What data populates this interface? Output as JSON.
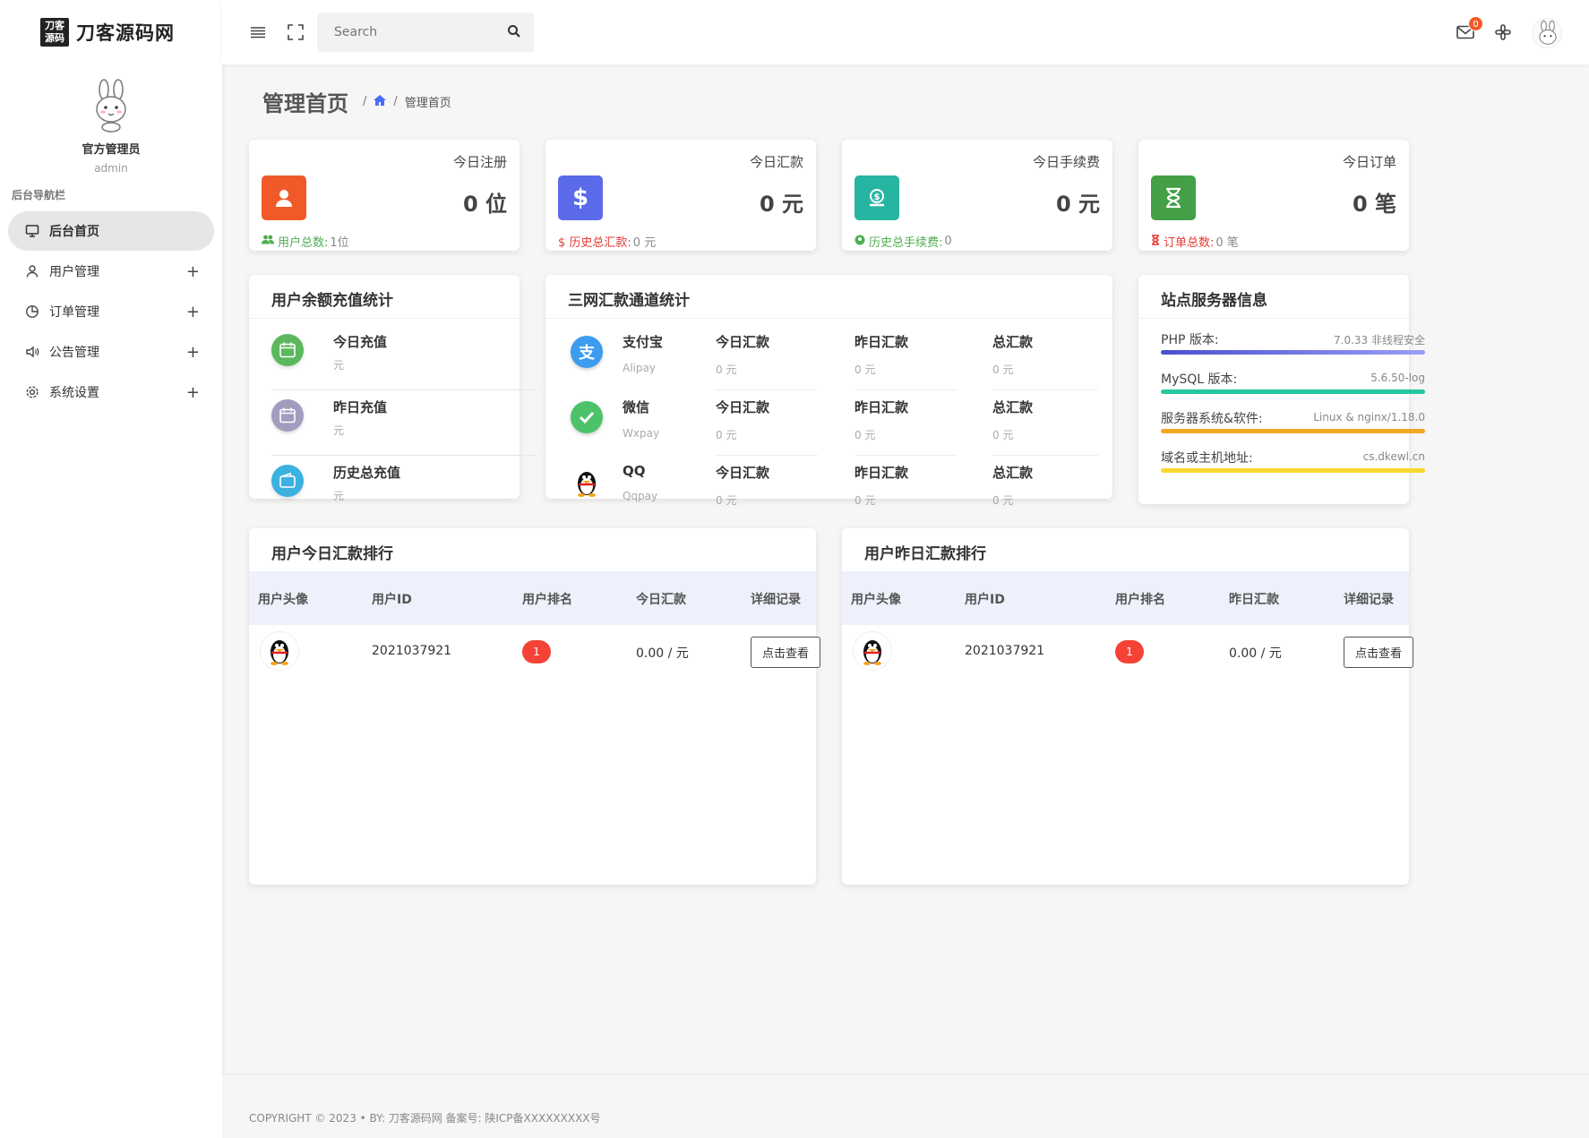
{
  "brand": {
    "logo_mark": "刀客源码",
    "name": "刀客源码网"
  },
  "profile": {
    "name": "官方管理员",
    "role": "admin"
  },
  "sidebar": {
    "title": "后台导航栏",
    "items": [
      {
        "label": "后台首页",
        "icon": "monitor-icon"
      },
      {
        "label": "用户管理",
        "icon": "user-icon"
      },
      {
        "label": "订单管理",
        "icon": "pie-chart-icon"
      },
      {
        "label": "公告管理",
        "icon": "speaker-icon"
      },
      {
        "label": "系统设置",
        "icon": "gear-icon"
      }
    ]
  },
  "topbar": {
    "search_placeholder": "Search",
    "mail_badge": "0"
  },
  "page": {
    "title": "管理首页",
    "breadcrumb": "管理首页"
  },
  "stats": [
    {
      "label": "今日注册",
      "value": "0 位",
      "foot_label": "用户总数:",
      "foot_value": "1位",
      "color": "#f05a28",
      "foot_color": "#4caf50"
    },
    {
      "label": "今日汇款",
      "value": "0 元",
      "foot_label": "$ 历史总汇款:",
      "foot_value": "0 元",
      "color": "#5a6ae8",
      "foot_color": "#e53935"
    },
    {
      "label": "今日手续费",
      "value": "0 元",
      "foot_label": "历史总手续费:",
      "foot_value": "0",
      "color": "#26b5a0",
      "foot_color": "#4caf50"
    },
    {
      "label": "今日订单",
      "value": "0 笔",
      "foot_label": "订单总数:",
      "foot_value": "0 笔",
      "color": "#43a047",
      "foot_color": "#e53935"
    }
  ],
  "recharge": {
    "title": "用户余额充值统计",
    "items": [
      {
        "label": "今日充值",
        "unit": "元",
        "color": "#5cb85c"
      },
      {
        "label": "昨日充值",
        "unit": "元",
        "color": "#a49bc0"
      },
      {
        "label": "历史总充值",
        "unit": "元",
        "color": "#3bb1e0"
      }
    ]
  },
  "channels": {
    "title": "三网汇款通道统计",
    "rows": [
      {
        "name": "支付宝",
        "en": "Alipay",
        "today": "今日汇款",
        "today_v": "0 元",
        "yest": "昨日汇款",
        "yest_v": "0 元",
        "total": "总汇款",
        "total_v": "0 元"
      },
      {
        "name": "微信",
        "en": "Wxpay",
        "today": "今日汇款",
        "today_v": "0 元",
        "yest": "昨日汇款",
        "yest_v": "0 元",
        "total": "总汇款",
        "total_v": "0 元"
      },
      {
        "name": "QQ",
        "en": "Qqpay",
        "today": "今日汇款",
        "today_v": "0 元",
        "yest": "昨日汇款",
        "yest_v": "0 元",
        "total": "总汇款",
        "total_v": "0 元"
      }
    ]
  },
  "server": {
    "title": "站点服务器信息",
    "items": [
      {
        "key": "PHP 版本:",
        "value": "7.0.33 非线程安全",
        "color": "#5b5fd6"
      },
      {
        "key": "MySQL 版本:",
        "value": "5.6.50-log",
        "color": "#26c6a0"
      },
      {
        "key": "服务器系统&软件:",
        "value": "Linux & nginx/1.18.0",
        "color": "#f5a623"
      },
      {
        "key": "域名或主机地址:",
        "value": "cs.dkewl.cn",
        "color": "#f7d731"
      }
    ]
  },
  "rank_today": {
    "title": "用户今日汇款排行",
    "headers": [
      "用户头像",
      "用户ID",
      "用户排名",
      "今日汇款",
      "详细记录"
    ],
    "row": {
      "id": "2021037921",
      "rank": "1",
      "amount": "0.00 / 元",
      "button": "点击查看"
    }
  },
  "rank_yesterday": {
    "title": "用户昨日汇款排行",
    "headers": [
      "用户头像",
      "用户ID",
      "用户排名",
      "昨日汇款",
      "详细记录"
    ],
    "row": {
      "id": "2021037921",
      "rank": "1",
      "amount": "0.00 / 元",
      "button": "点击查看"
    }
  },
  "footer": {
    "text": "COPYRIGHT © 2023  • BY: 刀客源码网   备案号: 陕ICP备XXXXXXXXX号"
  }
}
